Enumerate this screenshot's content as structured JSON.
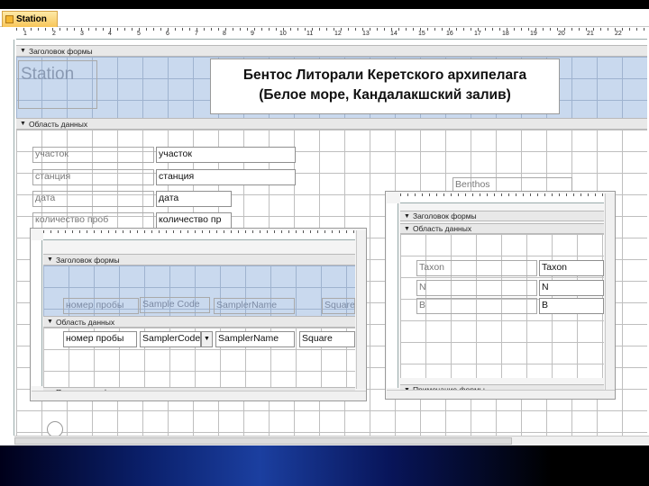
{
  "tab": {
    "title": "Station"
  },
  "main_form": {
    "ruler_numbers": [
      "1",
      "2",
      "3",
      "4",
      "5",
      "6",
      "7",
      "8",
      "9",
      "10",
      "11",
      "12",
      "13",
      "14",
      "15",
      "16",
      "17",
      "18",
      "19",
      "20",
      "21",
      "22"
    ],
    "header_bar": "Заголовок формы",
    "header_label": "Station",
    "title_line1": "Бентос Литорали Керетского архипелага",
    "title_line2": "(Белое море, Кандалакшский залив)",
    "detail_bar": "Область данных",
    "labels": [
      "участок",
      "станция",
      "дата",
      "количество проб"
    ],
    "fields": [
      "участок",
      "станция",
      "дата",
      "количество пр"
    ],
    "benthos_label": "Benthos"
  },
  "subform_left": {
    "header_bar": "Заголовок формы",
    "header_labels": [
      "номер пробы",
      "Sample Code",
      "SamplerName",
      "Square"
    ],
    "detail_bar": "Область данных",
    "detail_fields": [
      "номер пробы",
      "SamplerCode",
      "SamplerName",
      "Square"
    ],
    "footer_bar": "Примечание формы"
  },
  "subform_right": {
    "header_bar": "Заголовок формы",
    "detail_bar": "Область данных",
    "labels": [
      "Taxon",
      "N",
      "B"
    ],
    "fields": [
      "Taxon",
      "N",
      "B"
    ],
    "footer_bar": "Примечание формы"
  }
}
